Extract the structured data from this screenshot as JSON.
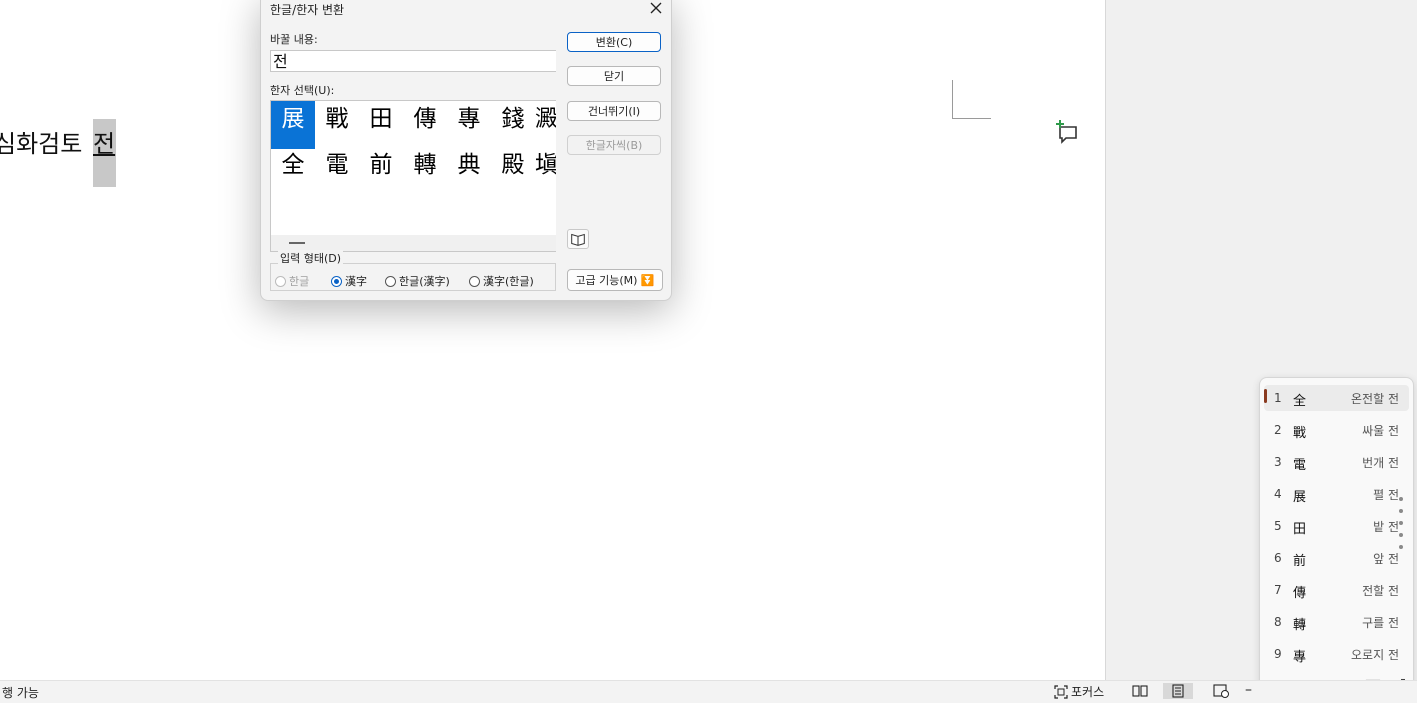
{
  "document": {
    "text_before": "심화검토 ",
    "selected_char": "전"
  },
  "status_bar": {
    "left_text": "행 가능",
    "focus_label": "포커스"
  },
  "dialog": {
    "title": "한글/한자 변환",
    "replace_label": "바꿀 내용:",
    "replace_value": "전",
    "hanja_select_label": "한자 선택(U):",
    "hanja_grid": [
      [
        "展",
        "戰",
        "田",
        "傳",
        "專",
        "錢",
        "澱"
      ],
      [
        "全",
        "電",
        "前",
        "轉",
        "典",
        "殿",
        "塡"
      ]
    ],
    "buttons": {
      "convert": "변환(C)",
      "close": "닫기",
      "skip": "건너뛰기(I)",
      "hangul_dict": "한글자씩(B)",
      "advanced": "고급 기능(M)"
    },
    "input_form": {
      "legend": "입력 형태(D)",
      "options": [
        "한글",
        "漢字",
        "한글(漢字)",
        "漢字(한글)"
      ],
      "selected": "漢字"
    }
  },
  "candidates": {
    "items": [
      {
        "num": "1",
        "hanja": "全",
        "meaning": "온전할 전"
      },
      {
        "num": "2",
        "hanja": "戰",
        "meaning": "싸울 전"
      },
      {
        "num": "3",
        "hanja": "電",
        "meaning": "번개 전"
      },
      {
        "num": "4",
        "hanja": "展",
        "meaning": "펼 전"
      },
      {
        "num": "5",
        "hanja": "田",
        "meaning": "밭 전"
      },
      {
        "num": "6",
        "hanja": "前",
        "meaning": "앞 전"
      },
      {
        "num": "7",
        "hanja": "傳",
        "meaning": "전할 전"
      },
      {
        "num": "8",
        "hanja": "轉",
        "meaning": "구를 전"
      },
      {
        "num": "9",
        "hanja": "專",
        "meaning": "오로지 전"
      }
    ],
    "selected_index": 0
  },
  "colors": {
    "accent": "#0a73d6",
    "selection_bar": "#8a3a1f",
    "comment_plus": "#2e9a4a"
  }
}
